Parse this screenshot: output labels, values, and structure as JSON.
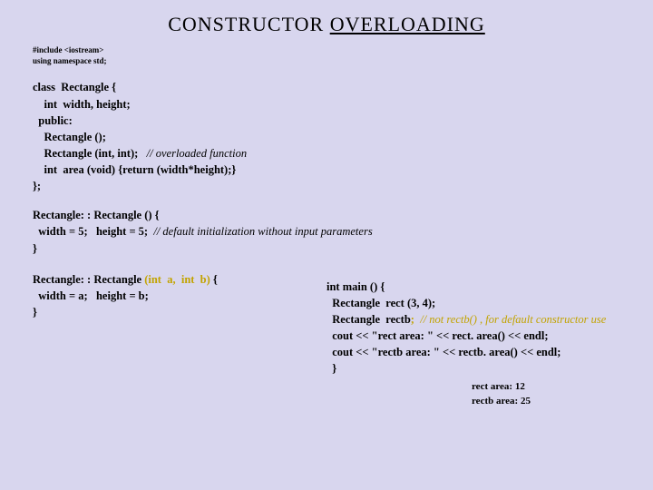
{
  "title": {
    "first": "CONSTRUCTOR ",
    "underlined": "OVERLOADING"
  },
  "includes": {
    "l1": "#include <iostream>",
    "l2": "using namespace std;"
  },
  "classdef": {
    "l1": "class  Rectangle {",
    "l2": "    int  width, height;",
    "l3": "  public:",
    "l4": "    Rectangle ();",
    "l5a": "    Rectangle (int, int);   ",
    "l5c": "// overloaded function",
    "l6": "    int  area (void) {return (width*height);}",
    "l7": "};"
  },
  "ctor0": {
    "l1": "Rectangle: : Rectangle () {",
    "l2a": "  width = 5;   height = 5;  ",
    "l2c": "// default initialization without input parameters",
    "l3": "}"
  },
  "ctor1": {
    "l1a": "Rectangle: : Rectangle ",
    "l1b": "(int  a,  int  b)",
    "l1c": " {",
    "l2": "  width = a;   height = b;",
    "l3": "}"
  },
  "main": {
    "l1": "int main () {",
    "l2": "  Rectangle  rect (3, 4);",
    "l3a": "  Rectangle  rectb",
    "l3b": ";  ",
    "l3c": "// not rectb() , for default constructor use",
    "l4": "  cout << \"rect area: \" << rect. area() << endl;",
    "l5": "  cout << \"rectb area: \" << rectb. area() << endl;",
    "l6": "  }"
  },
  "output": {
    "l1": "rect area: 12",
    "l2": "rectb area: 25"
  }
}
